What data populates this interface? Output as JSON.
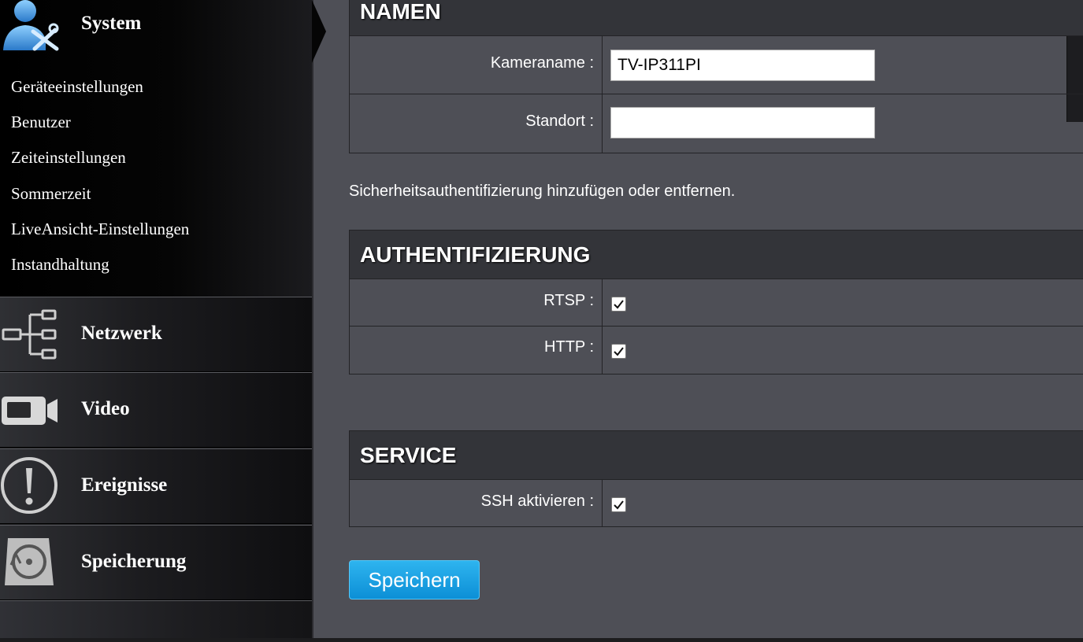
{
  "sidebar": {
    "system": {
      "label": "System",
      "icon": "user-wrench-icon",
      "items": [
        {
          "label": "Geräteeinstellungen"
        },
        {
          "label": "Benutzer"
        },
        {
          "label": "Zeiteinstellungen"
        },
        {
          "label": "Sommerzeit"
        },
        {
          "label": "LiveAnsicht-Einstellungen"
        },
        {
          "label": "Instandhaltung"
        }
      ]
    },
    "sections": [
      {
        "label": "Netzwerk",
        "icon": "network-tree-icon"
      },
      {
        "label": "Video",
        "icon": "video-camera-icon"
      },
      {
        "label": "Ereignisse",
        "icon": "exclamation-icon"
      },
      {
        "label": "Speicherung",
        "icon": "storage-disk-icon"
      }
    ]
  },
  "names_panel": {
    "title": "NAMEN",
    "camera_name_label": "Kameraname :",
    "camera_name_value": "TV-IP311PI",
    "location_label": "Standort :",
    "location_value": ""
  },
  "info_text": "Sicherheitsauthentifizierung hinzufügen oder entfernen.",
  "auth_panel": {
    "title": "AUTHENTIFIZIERUNG",
    "rtsp_label": "RTSP :",
    "rtsp_checked": true,
    "http_label": "HTTP :",
    "http_checked": true
  },
  "service_panel": {
    "title": "SERVICE",
    "ssh_label": "SSH aktivieren :",
    "ssh_checked": true
  },
  "save_label": "Speichern",
  "colors": {
    "accent": "#1a9fe0",
    "background": "#4e4f56",
    "panel_header": "#333439"
  }
}
